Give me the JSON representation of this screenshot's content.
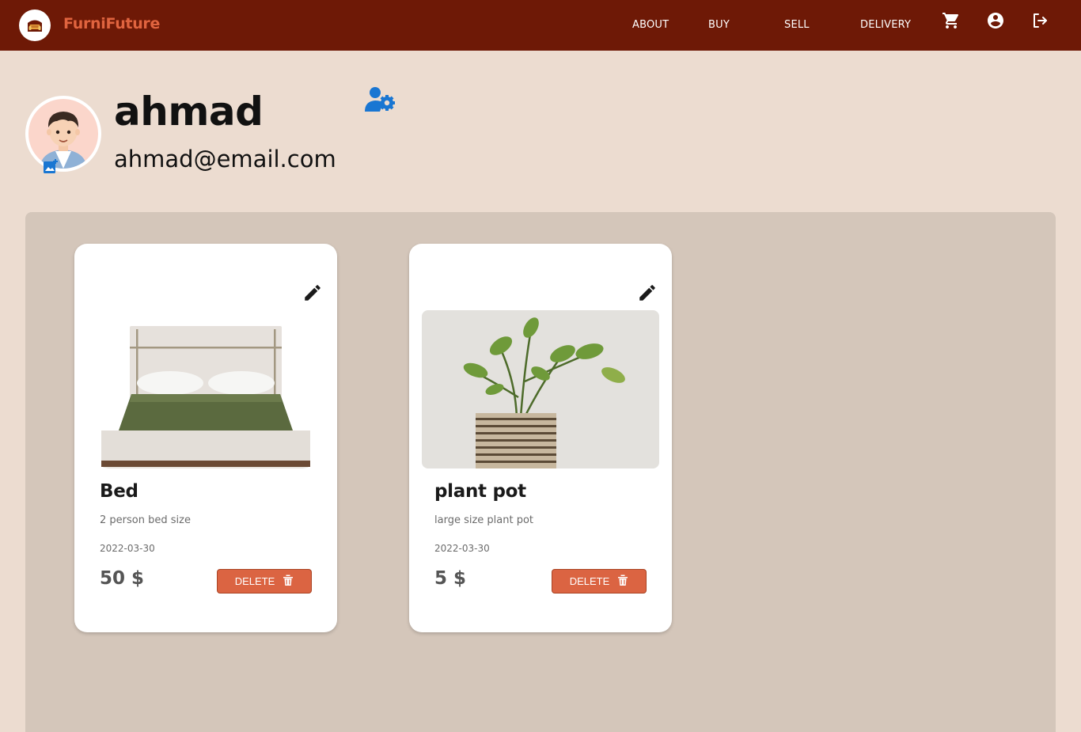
{
  "nav": {
    "brand": "FurniFuture",
    "links": [
      "ABOUT",
      "BUY",
      "SELL",
      "DELIVERY"
    ],
    "icons": [
      "cart-icon",
      "account-circle-icon",
      "logout-icon"
    ]
  },
  "profile": {
    "name": "ahmad",
    "email": "ahmad@email.com"
  },
  "products": [
    {
      "title": "Bed",
      "description": "2 person bed size",
      "date": "2022-03-30",
      "price": "50 $",
      "delete_label": "DELETE",
      "image": "bed-photo"
    },
    {
      "title": "plant pot",
      "description": "large size plant pot",
      "date": "2022-03-30",
      "price": "5 $",
      "delete_label": "DELETE",
      "image": "plant-pot-photo"
    }
  ],
  "colors": {
    "navbar": "#6e1906",
    "brand": "#e0643f",
    "page_background": "#ecdcd0",
    "panel": "#d4c6ba",
    "delete_button": "#db6442",
    "accent_blue": "#1976d2"
  }
}
